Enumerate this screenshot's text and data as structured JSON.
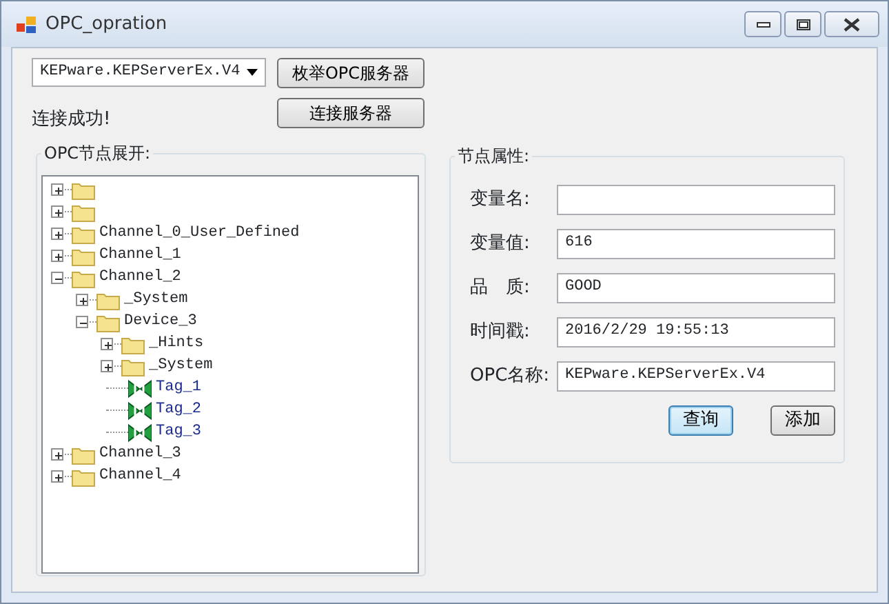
{
  "window": {
    "title": "OPC_opration"
  },
  "server_select": {
    "value": "KEPware.KEPServerEx.V4"
  },
  "buttons_top": [
    {
      "label": "枚举OPC服务器"
    },
    {
      "label": "连接服务器"
    }
  ],
  "status_text": "连接成功!",
  "tree_group": {
    "title": "OPC节点展开:"
  },
  "tree": [
    {
      "kind": "folder",
      "expanded": false
    },
    {
      "kind": "folder",
      "expanded": false
    },
    {
      "kind": "folder",
      "label": "Channel_0_User_Defined",
      "expanded": false
    },
    {
      "kind": "folder",
      "label": "Channel_1",
      "expanded": false
    },
    {
      "kind": "folder",
      "label": "Channel_2",
      "expanded": true,
      "children": [
        {
          "kind": "folder",
          "label": "_System",
          "expanded": false
        },
        {
          "kind": "folder",
          "label": "Device_3",
          "expanded": true,
          "children": [
            {
              "kind": "folder",
              "label": "_Hints",
              "expanded": false
            },
            {
              "kind": "folder",
              "label": "_System",
              "expanded": false
            },
            {
              "kind": "tag",
              "label": "Tag_1"
            },
            {
              "kind": "tag",
              "label": "Tag_2"
            },
            {
              "kind": "tag",
              "label": "Tag_3"
            }
          ]
        }
      ]
    },
    {
      "kind": "folder",
      "label": "Channel_3",
      "expanded": false
    },
    {
      "kind": "folder",
      "label": "Channel_4",
      "expanded": false
    }
  ],
  "properties": {
    "title": "节点属性:",
    "fields": [
      {
        "label": "变量名:"
      },
      {
        "label": "变量值:",
        "value": "616"
      },
      {
        "label": "品　质:",
        "value": "GOOD"
      },
      {
        "label": "时间戳:",
        "value": "2016/2/29 19:55:13"
      },
      {
        "label": "OPC名称:",
        "value": "KEPware.KEPServerEx.V4"
      }
    ],
    "buttons": [
      {
        "label": "查询",
        "focused": true
      },
      {
        "label": "添加",
        "focused": false
      }
    ]
  }
}
